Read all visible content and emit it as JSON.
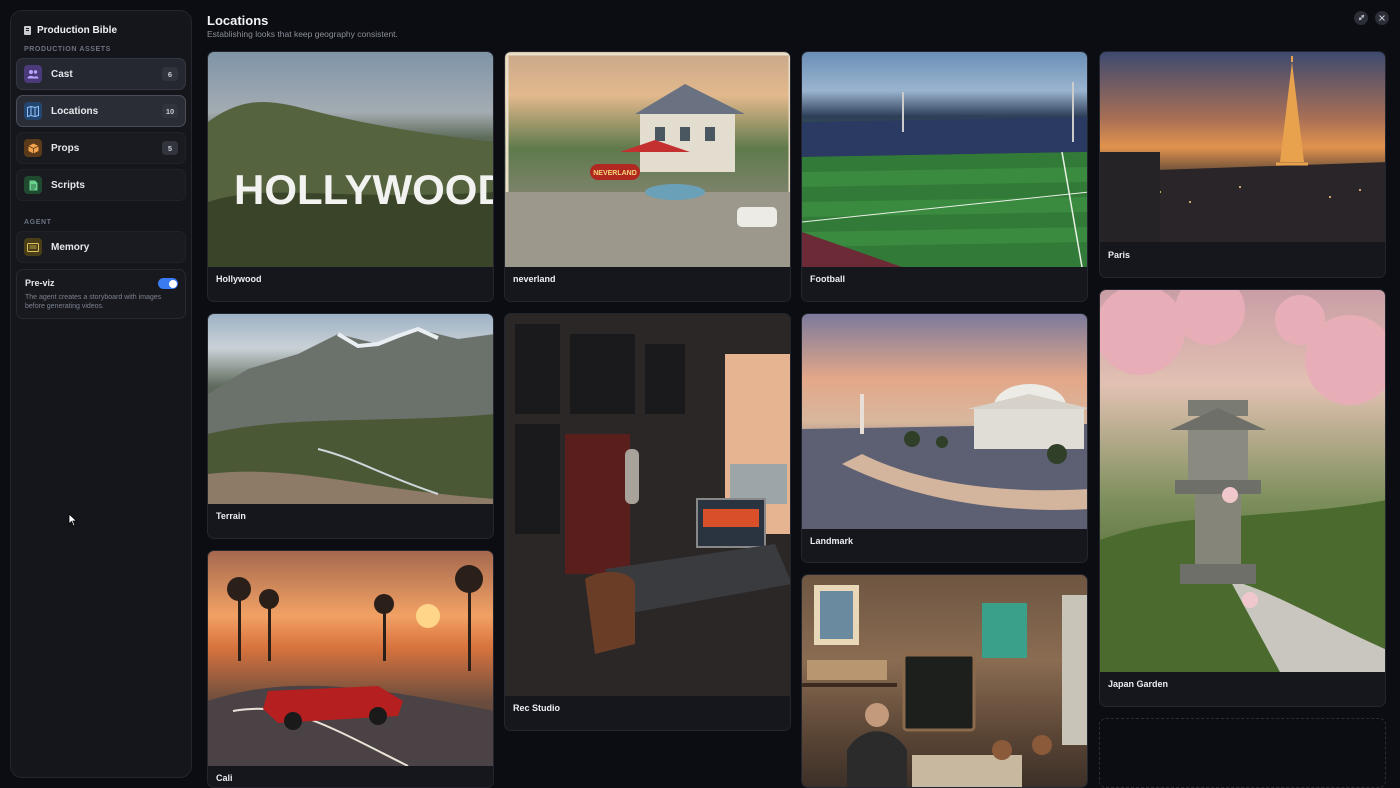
{
  "sidebar": {
    "title": "Production Bible",
    "section_assets": "PRODUCTION ASSETS",
    "items": [
      {
        "label": "Cast",
        "count": "6",
        "icon": "people-icon"
      },
      {
        "label": "Locations",
        "count": "10",
        "icon": "map-icon"
      },
      {
        "label": "Props",
        "count": "5",
        "icon": "box-icon"
      },
      {
        "label": "Scripts",
        "count": "",
        "icon": "document-icon"
      }
    ],
    "section_agent": "AGENT",
    "memory_label": "Memory",
    "previz": {
      "title": "Pre-viz",
      "description": "The agent creates a storyboard with images before generating videos.",
      "enabled": true
    }
  },
  "header": {
    "title": "Locations",
    "subtitle": "Establishing looks that keep geography consistent."
  },
  "locations": [
    {
      "name": "Hollywood"
    },
    {
      "name": "neverland"
    },
    {
      "name": "Football"
    },
    {
      "name": "Paris"
    },
    {
      "name": "Terrain"
    },
    {
      "name": "Rec Studio"
    },
    {
      "name": "Landmark"
    },
    {
      "name": "Japan Garden"
    },
    {
      "name": "Cali"
    },
    {
      "name": ""
    }
  ],
  "image_text": {
    "hollywood_sign": "HOLLYWOOD",
    "neverland_sign": "NEVERLAND"
  },
  "colors": {
    "accent": "#3a7bf2",
    "background": "#0b0d12",
    "card": "#15171d"
  }
}
